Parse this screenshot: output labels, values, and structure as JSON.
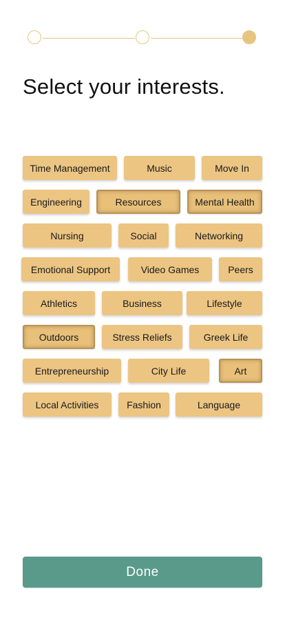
{
  "stepper": {
    "total_steps": 3,
    "current_step": 3,
    "color": "#e8c47f"
  },
  "title": "Select your interests.",
  "tag_color": "#ecc583",
  "interests": [
    {
      "label": "Time Management",
      "selected": false
    },
    {
      "label": "Music",
      "selected": false
    },
    {
      "label": "Move In",
      "selected": false
    },
    {
      "label": "Engineering",
      "selected": false
    },
    {
      "label": "Resources",
      "selected": true
    },
    {
      "label": "Mental Health",
      "selected": true
    },
    {
      "label": "Nursing",
      "selected": false
    },
    {
      "label": "Social",
      "selected": false
    },
    {
      "label": "Networking",
      "selected": false
    },
    {
      "label": "Emotional Support",
      "selected": false
    },
    {
      "label": "Video Games",
      "selected": false
    },
    {
      "label": "Peers",
      "selected": false
    },
    {
      "label": "Athletics",
      "selected": false
    },
    {
      "label": "Business",
      "selected": false
    },
    {
      "label": "Lifestyle",
      "selected": false
    },
    {
      "label": "Outdoors",
      "selected": true
    },
    {
      "label": "Stress Reliefs",
      "selected": false
    },
    {
      "label": "Greek Life",
      "selected": false
    },
    {
      "label": "Entrepreneurship",
      "selected": false
    },
    {
      "label": "City Life",
      "selected": false
    },
    {
      "label": "Art",
      "selected": true
    },
    {
      "label": "Local Activities",
      "selected": false
    },
    {
      "label": "Fashion",
      "selected": false
    },
    {
      "label": "Language",
      "selected": false
    }
  ],
  "done_button": {
    "label": "Done",
    "color": "#5a9a8b"
  }
}
